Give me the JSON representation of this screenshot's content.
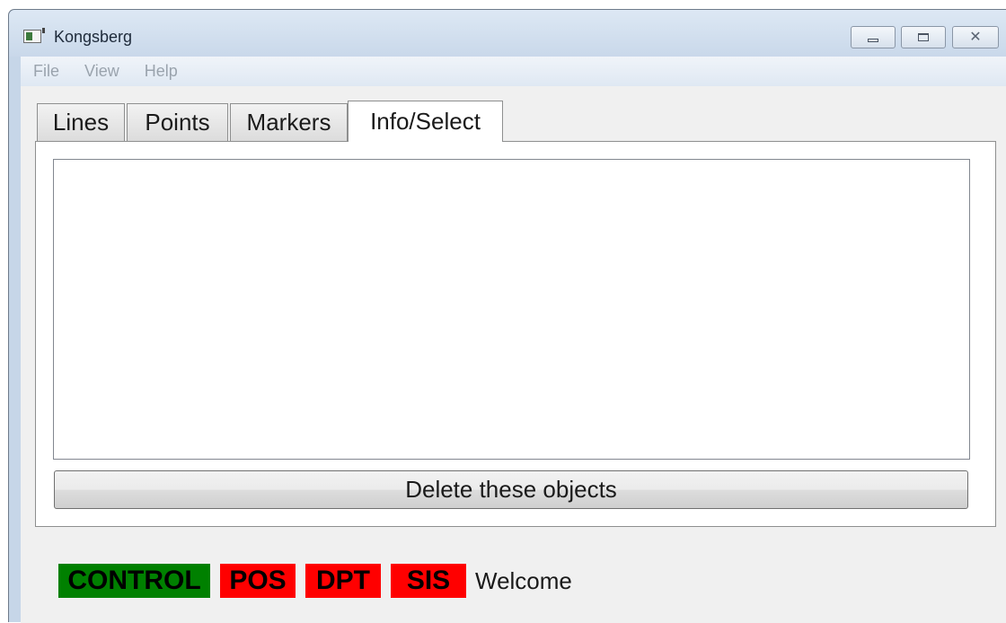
{
  "window": {
    "title": "Kongsberg",
    "caption_buttons": [
      "minimize",
      "maximize",
      "close"
    ]
  },
  "menubar": {
    "items": [
      "File",
      "View",
      "Help"
    ]
  },
  "tabs": [
    {
      "label": "Lines",
      "selected": false
    },
    {
      "label": "Points",
      "selected": false
    },
    {
      "label": "Markers",
      "selected": false
    },
    {
      "label": "Info/Select",
      "selected": true
    }
  ],
  "info_select": {
    "delete_button_label": "Delete these objects"
  },
  "status": {
    "indicators": [
      {
        "label": "CONTROL",
        "color": "#008000"
      },
      {
        "label": "POS",
        "color": "#ff0000"
      },
      {
        "label": "DPT",
        "color": "#ff0000"
      },
      {
        "label": "SIS",
        "color": "#ff0000"
      }
    ],
    "message": "Welcome"
  },
  "colors": {
    "ok": "#008000",
    "alert": "#ff0000",
    "window_frame": "#c6d6e8",
    "client_bg": "#f0f0f0"
  }
}
